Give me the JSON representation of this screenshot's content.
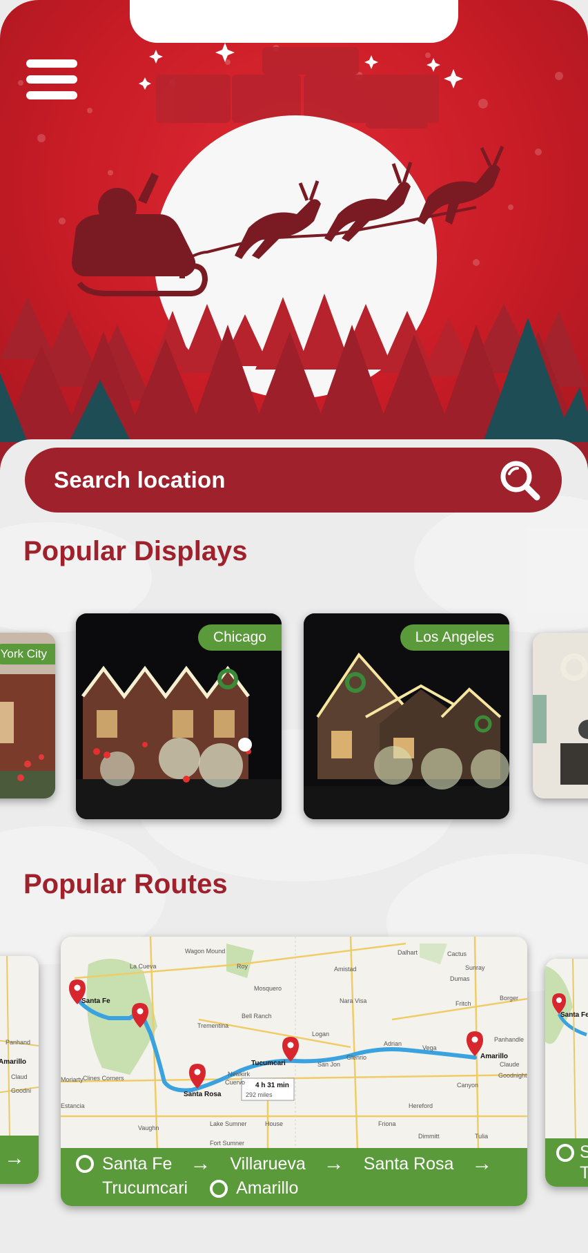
{
  "header": {
    "menu_icon": "hamburger-menu-icon",
    "colors": {
      "hero_red": "#c81c26",
      "brand_red": "#9e212c",
      "accent_green": "#5a9a3a"
    }
  },
  "search": {
    "placeholder": "Search location",
    "icon": "search-icon"
  },
  "popular_displays": {
    "title": "Popular Displays",
    "cards": [
      {
        "city": "York City"
      },
      {
        "city": "Chicago"
      },
      {
        "city": "Los Angeles"
      },
      {
        "city": ""
      }
    ]
  },
  "popular_routes": {
    "title": "Popular Routes",
    "route": {
      "stops": [
        "Santa Fe",
        "Villarueva",
        "Santa Rosa",
        "Trucumcari",
        "Amarillo"
      ],
      "map_labels": {
        "santa_fe": "Santa Fe",
        "santa_rosa": "Santa Rosa",
        "tucumcari": "Tucumcari",
        "amarillo": "Amarillo",
        "duration": "4 h 31 min",
        "distance": "292 miles",
        "places": [
          "Wagon Mound",
          "La Cueva",
          "Roy",
          "Mosquero",
          "Amistad",
          "Dalhart",
          "Cactus",
          "Sunray",
          "Dumas",
          "Nara Visa",
          "Bell Ranch",
          "Trementina",
          "Logan",
          "Adrian",
          "Vega",
          "Clines Corners",
          "Newkirk",
          "Cuervo",
          "San Jon",
          "Glenrio",
          "Canyon",
          "Hereford",
          "Vaughn",
          "Lake Sumner",
          "House",
          "Friona",
          "Dimmitt",
          "Tulia",
          "Fort Sumner",
          "Borger",
          "Panhandle",
          "Claude",
          "Goodnight",
          "Fritch",
          "Moriarty",
          "Estancia"
        ]
      }
    },
    "side_left_labels": {
      "place1": "Panhand",
      "place2": "Amarillo",
      "place3": "Claud",
      "place4": "Goodni"
    },
    "side_right_labels": {
      "city": "Santa Fe",
      "stop": "S",
      "stop2": "T"
    }
  }
}
